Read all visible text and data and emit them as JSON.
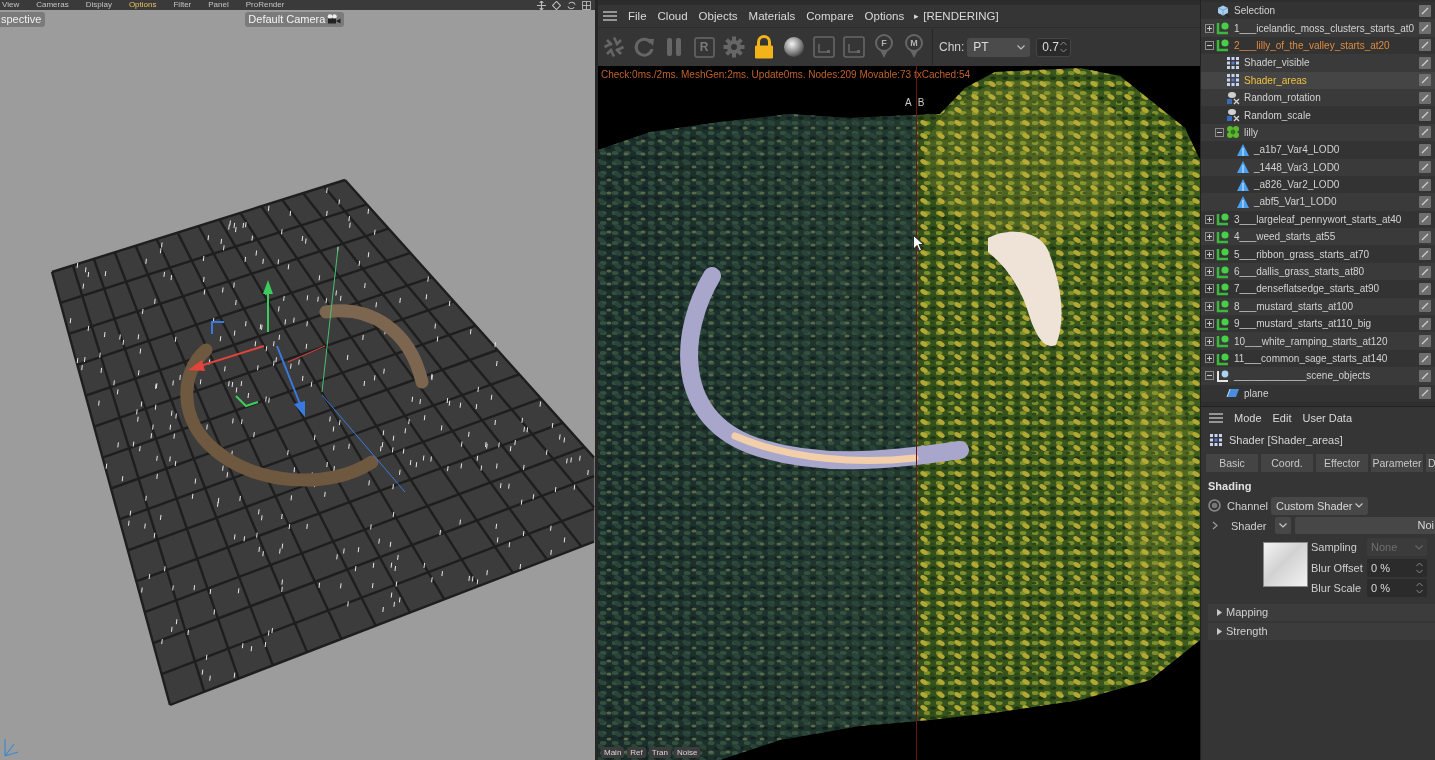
{
  "viewport": {
    "menu": [
      {
        "label": "View",
        "selected": false
      },
      {
        "label": "Cameras",
        "selected": false
      },
      {
        "label": "Display",
        "selected": false
      },
      {
        "label": "Options",
        "selected": true
      },
      {
        "label": "Filter",
        "selected": false
      },
      {
        "label": "Panel",
        "selected": false
      },
      {
        "label": "ProRender",
        "selected": false
      }
    ],
    "view_name": "spective",
    "camera": "Default Camera"
  },
  "render_window": {
    "menu": [
      "File",
      "Cloud",
      "Objects",
      "Materials",
      "Compare",
      "Options"
    ],
    "arrow": "▸",
    "status": "[RENDERING]",
    "tools": [
      {
        "kind": "aperture",
        "on": false
      },
      {
        "kind": "refresh",
        "on": false
      },
      {
        "kind": "pause",
        "on": false
      },
      {
        "kind": "letter",
        "label": "R",
        "on": false
      },
      {
        "kind": "gear",
        "on": false
      },
      {
        "kind": "lock",
        "on": true
      },
      {
        "kind": "sphere",
        "on": false
      },
      {
        "kind": "region",
        "on": false
      },
      {
        "kind": "region",
        "on": false
      },
      {
        "kind": "pin",
        "label": "F",
        "on": false
      },
      {
        "kind": "pin",
        "label": "M",
        "on": false
      }
    ],
    "channel_label": "Chn:",
    "channel": "PT",
    "value": "0.7",
    "stats": "Check:0ms./2ms. MeshGen:2ms. Update0ms. Nodes:209 Movable:73 txCached:54",
    "compare_labels": [
      "A",
      "B"
    ],
    "tabs": [
      {
        "label": "Main",
        "selected": false
      },
      {
        "label": "Ref",
        "selected": false
      },
      {
        "label": "Tran",
        "selected": false
      },
      {
        "label": "Noise",
        "selected": false
      }
    ]
  },
  "objects": {
    "items": [
      {
        "label": "Selection",
        "kind": "selection",
        "selected": false,
        "active": false
      },
      {
        "label": "1___icelandic_moss_clusters_starts_at0",
        "kind": "scatter",
        "expanded": false,
        "selected": false,
        "active": false
      },
      {
        "label": "2___lilly_of_the_valley_starts_at20",
        "kind": "scatter",
        "expanded": true,
        "selected": true,
        "active": false,
        "children": [
          {
            "label": "Shader_visible",
            "kind": "shader_effector",
            "selected": false,
            "active": false
          },
          {
            "label": "Shader_areas",
            "kind": "shader_effector",
            "selected": true,
            "active": true
          },
          {
            "label": "Random_rotation",
            "kind": "random_effector",
            "selected": false,
            "active": false
          },
          {
            "label": "Random_scale",
            "kind": "random_effector",
            "selected": false,
            "active": false
          },
          {
            "label": "lilly",
            "kind": "cluster",
            "expanded": true,
            "selected": false,
            "active": false,
            "children": [
              {
                "label": "_a1b7_Var4_LOD0",
                "kind": "polygon",
                "selected": false,
                "active": false
              },
              {
                "label": "_1448_Var3_LOD0",
                "kind": "polygon",
                "selected": false,
                "active": false
              },
              {
                "label": "_a826_Var2_LOD0",
                "kind": "polygon",
                "selected": false,
                "active": false
              },
              {
                "label": "_abf5_Var1_LOD0",
                "kind": "polygon",
                "selected": false,
                "active": false
              }
            ]
          }
        ]
      },
      {
        "label": "3___largeleaf_pennywort_starts_at40",
        "kind": "scatter",
        "expanded": false,
        "selected": false,
        "active": false
      },
      {
        "label": "4___weed_starts_at55",
        "kind": "scatter",
        "expanded": false,
        "selected": false,
        "active": false
      },
      {
        "label": "5___ribbon_grass_starts_at70",
        "kind": "scatter",
        "expanded": false,
        "selected": false,
        "active": false
      },
      {
        "label": "6___dallis_grass_starts_at80",
        "kind": "scatter",
        "expanded": false,
        "selected": false,
        "active": false
      },
      {
        "label": "7___denseflatsedge_starts_at90",
        "kind": "scatter",
        "expanded": false,
        "selected": false,
        "active": false
      },
      {
        "label": "8___mustard_starts_at100",
        "kind": "scatter",
        "expanded": false,
        "selected": false,
        "active": false
      },
      {
        "label": "9___mustard_starts_at110_big",
        "kind": "scatter",
        "expanded": false,
        "selected": false,
        "active": false
      },
      {
        "label": "10___white_ramping_starts_at120",
        "kind": "scatter",
        "expanded": false,
        "selected": false,
        "active": false
      },
      {
        "label": "11___common_sage_starts_at140",
        "kind": "scatter",
        "expanded": false,
        "selected": false,
        "active": false
      },
      {
        "label": "_____________scene_objects",
        "kind": "null",
        "expanded": true,
        "selected": false,
        "active": false,
        "children": [
          {
            "label": "plane",
            "kind": "plane",
            "selected": false,
            "active": false
          }
        ]
      }
    ]
  },
  "attributes": {
    "menu": [
      "Mode",
      "Edit",
      "User Data"
    ],
    "title": "Shader [Shader_areas]",
    "tabs": [
      {
        "label": "Basic",
        "selected": false
      },
      {
        "label": "Coord.",
        "selected": false
      },
      {
        "label": "Effector",
        "selected": false
      },
      {
        "label": "Parameter",
        "selected": false
      },
      {
        "label": "D",
        "selected": false
      }
    ],
    "section": "Shading",
    "channel": {
      "label": "Channel",
      "value": "Custom Shader"
    },
    "shader": {
      "label": "Shader",
      "value": "Noi",
      "expanded": false
    },
    "options": [
      {
        "label": "Sampling",
        "value": "None",
        "kind": "dropdown",
        "disabled": true
      },
      {
        "label": "Blur Offset",
        "value": "0 %",
        "kind": "spinner",
        "disabled": false
      },
      {
        "label": "Blur Scale",
        "value": "0 %",
        "kind": "spinner",
        "disabled": false
      }
    ],
    "groups": [
      {
        "label": "Mapping",
        "expanded": false
      },
      {
        "label": "Strength",
        "expanded": false
      }
    ]
  }
}
